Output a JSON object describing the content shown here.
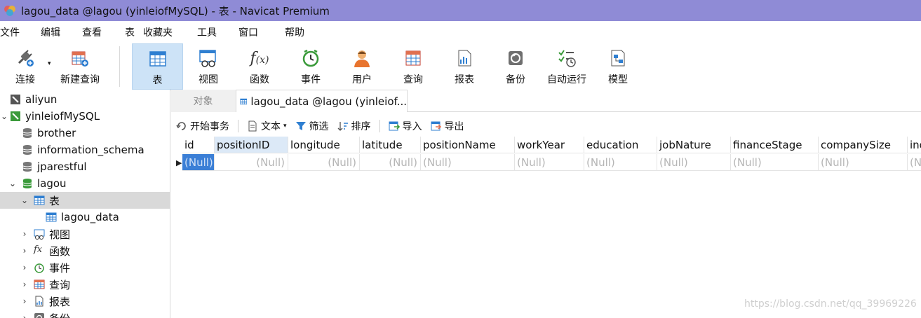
{
  "window": {
    "title": "lagou_data @lagou (yinleiofMySQL) - 表 - Navicat Premium"
  },
  "menu": [
    "文件",
    "编辑",
    "查看",
    "表",
    "收藏夹",
    "工具",
    "窗口",
    "帮助"
  ],
  "toolbar": {
    "connect": "连接",
    "new_query": "新建查询",
    "table": "表",
    "view": "视图",
    "function": "函数",
    "event": "事件",
    "user": "用户",
    "query": "查询",
    "report": "报表",
    "backup": "备份",
    "automation": "自动运行",
    "model": "模型"
  },
  "sidebar": {
    "connections": [
      "aliyun",
      "yinleiofMySQL"
    ],
    "databases": [
      "brother",
      "information_schema",
      "jparestful",
      "lagou"
    ],
    "lagou_children": {
      "tables_group": "表",
      "table": "lagou_data"
    },
    "groups": [
      "视图",
      "函数",
      "事件",
      "查询",
      "报表",
      "备份"
    ]
  },
  "tabs": {
    "objects": "对象",
    "active": "lagou_data @lagou (yinleiof..."
  },
  "subtoolbar": {
    "begin_transaction": "开始事务",
    "text": "文本",
    "filter": "筛选",
    "sort": "排序",
    "import": "导入",
    "export": "导出"
  },
  "grid": {
    "columns": [
      "id",
      "positionID",
      "longitude",
      "latitude",
      "positionName",
      "workYear",
      "education",
      "jobNature",
      "financeStage",
      "companySize",
      "ind"
    ],
    "row": [
      "(Null)",
      "(Null)",
      "(Null)",
      "(Null)",
      "(Null)",
      "(Null)",
      "(Null)",
      "(Null)",
      "(Null)",
      "(Null)",
      "(N"
    ]
  },
  "watermark": "https://blog.csdn.net/qq_39969226",
  "colors": {
    "titlebar": "#8f8bd6",
    "selection": "#3b7fd6",
    "toolbar_active": "#cde3f7"
  }
}
